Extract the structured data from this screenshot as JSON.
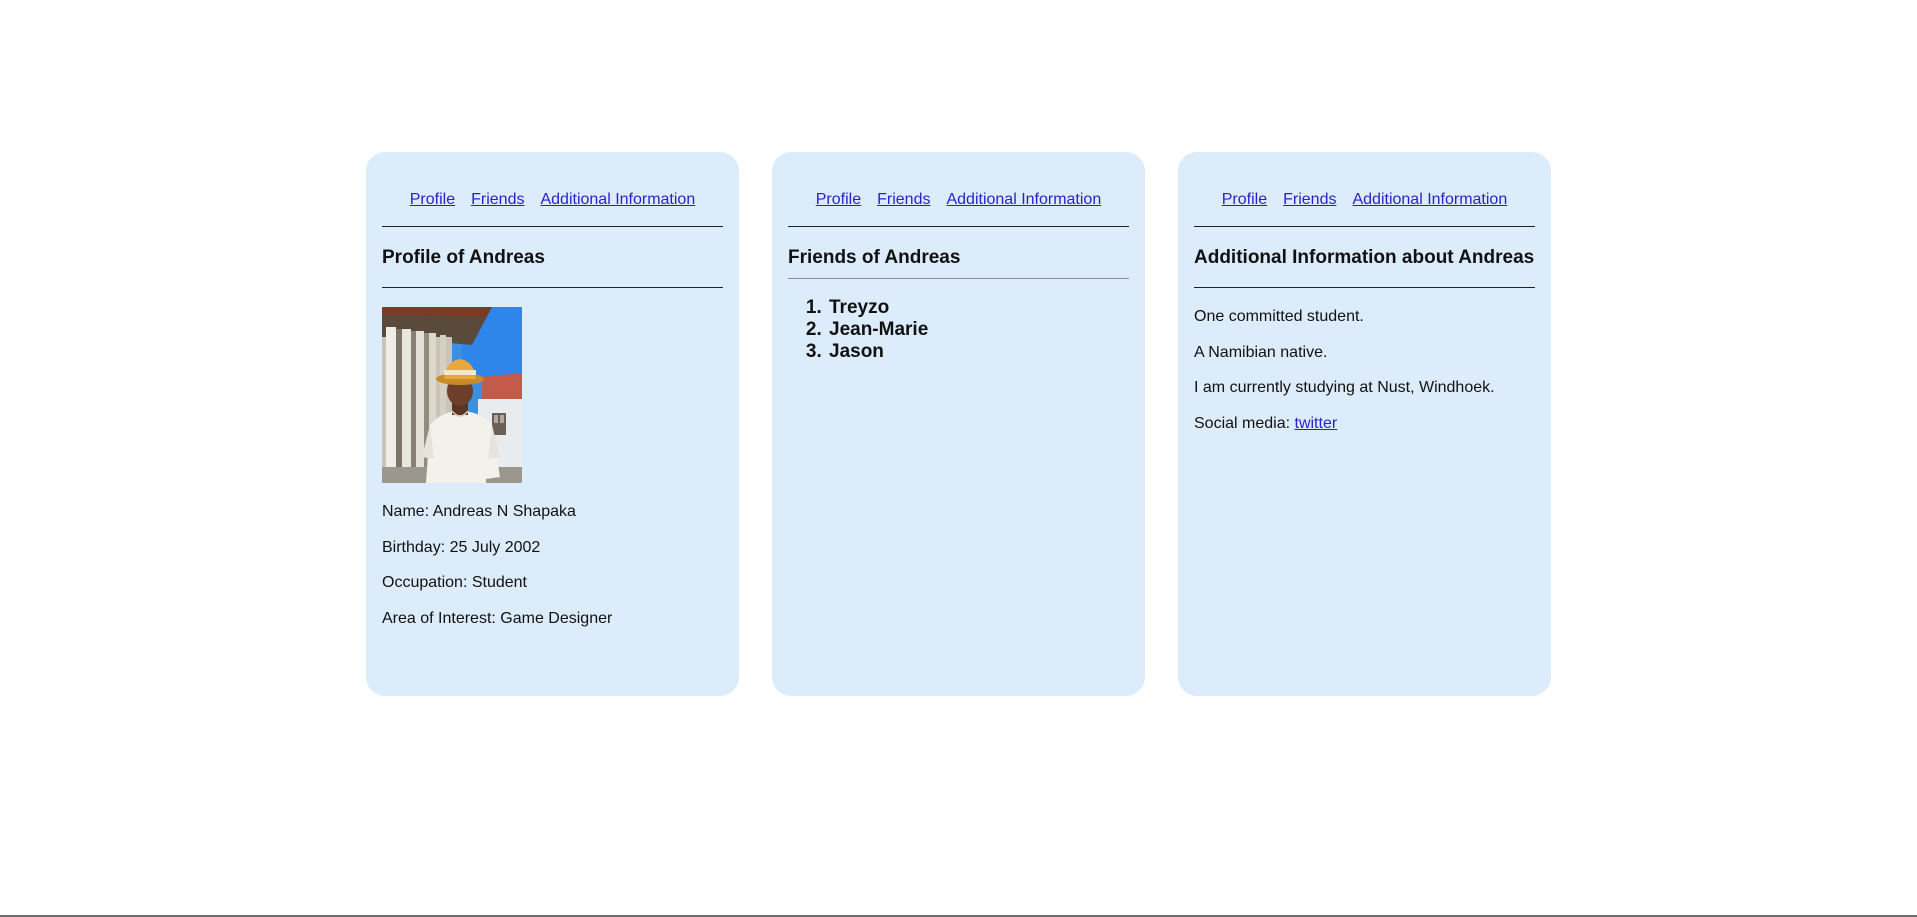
{
  "nav": {
    "profile": "Profile",
    "friends": "Friends",
    "additional": "Additional Information"
  },
  "profile_card": {
    "title": "Profile of Andreas",
    "photo_alt": "",
    "name": "Name: Andreas N Shapaka",
    "birthday": "Birthday: 25 July 2002",
    "occupation": "Occupation: Student",
    "interest": "Area of Interest: Game Designer"
  },
  "friends_card": {
    "title": "Friends of Andreas",
    "friends": [
      "Treyzo",
      "Jean-Marie",
      "Jason"
    ]
  },
  "additional_card": {
    "title": "Additional Information about Andreas",
    "lines": [
      "One committed student.",
      "A Namibian native.",
      "I am currently studying at Nust, Windhoek."
    ],
    "social_label": "Social media: ",
    "social_link": "twitter"
  },
  "colors": {
    "card_bg": "#dcecfb",
    "link": "#2a1fcc",
    "text": "#111111"
  }
}
